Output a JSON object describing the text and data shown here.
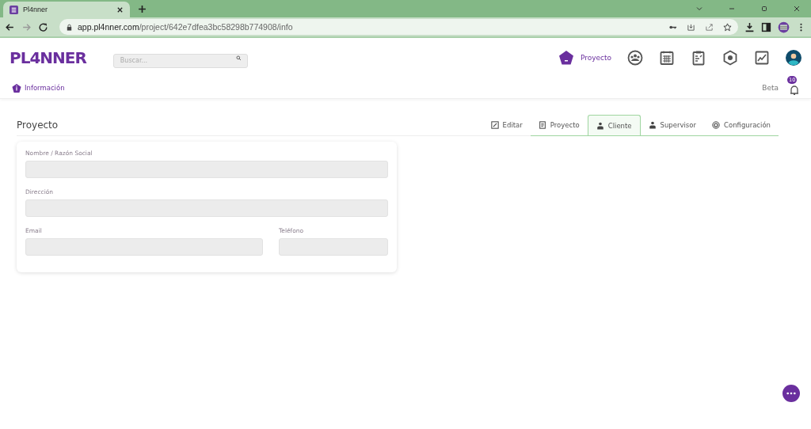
{
  "browser": {
    "tab_title": "Pl4nner",
    "url_host": "app.pl4nner.com",
    "url_path": "/project/642e7dfea3bc58298b774908/info"
  },
  "header": {
    "logo": "PL4NNER",
    "search": {
      "placeholder": "Buscar..."
    },
    "nav": [
      {
        "kind": "project",
        "label": "Proyecto",
        "selected": true
      },
      {
        "kind": "team",
        "selected": false
      },
      {
        "kind": "calendar",
        "selected": false
      },
      {
        "kind": "clipboard",
        "selected": false
      },
      {
        "kind": "hexagon",
        "selected": false
      },
      {
        "kind": "chart",
        "selected": false
      }
    ]
  },
  "subheader": {
    "section": "Información",
    "beta": "Beta",
    "notifications": "10"
  },
  "page": {
    "title": "Proyecto",
    "edit": "Editar",
    "tabs": [
      {
        "kind": "document",
        "label": "Proyecto",
        "selected": false
      },
      {
        "kind": "person",
        "label": "Cliente",
        "selected": true
      },
      {
        "kind": "person",
        "label": "Supervisor",
        "selected": false
      },
      {
        "kind": "gear",
        "label": "Configuración",
        "selected": false
      }
    ],
    "fields": [
      {
        "label": "Nombre / Razón Social",
        "kind": "full"
      },
      {
        "label": "Dirección",
        "kind": "full"
      },
      {
        "label": "Email",
        "kind": "wide"
      },
      {
        "label": "Teléfono",
        "kind": "narrow"
      }
    ]
  }
}
